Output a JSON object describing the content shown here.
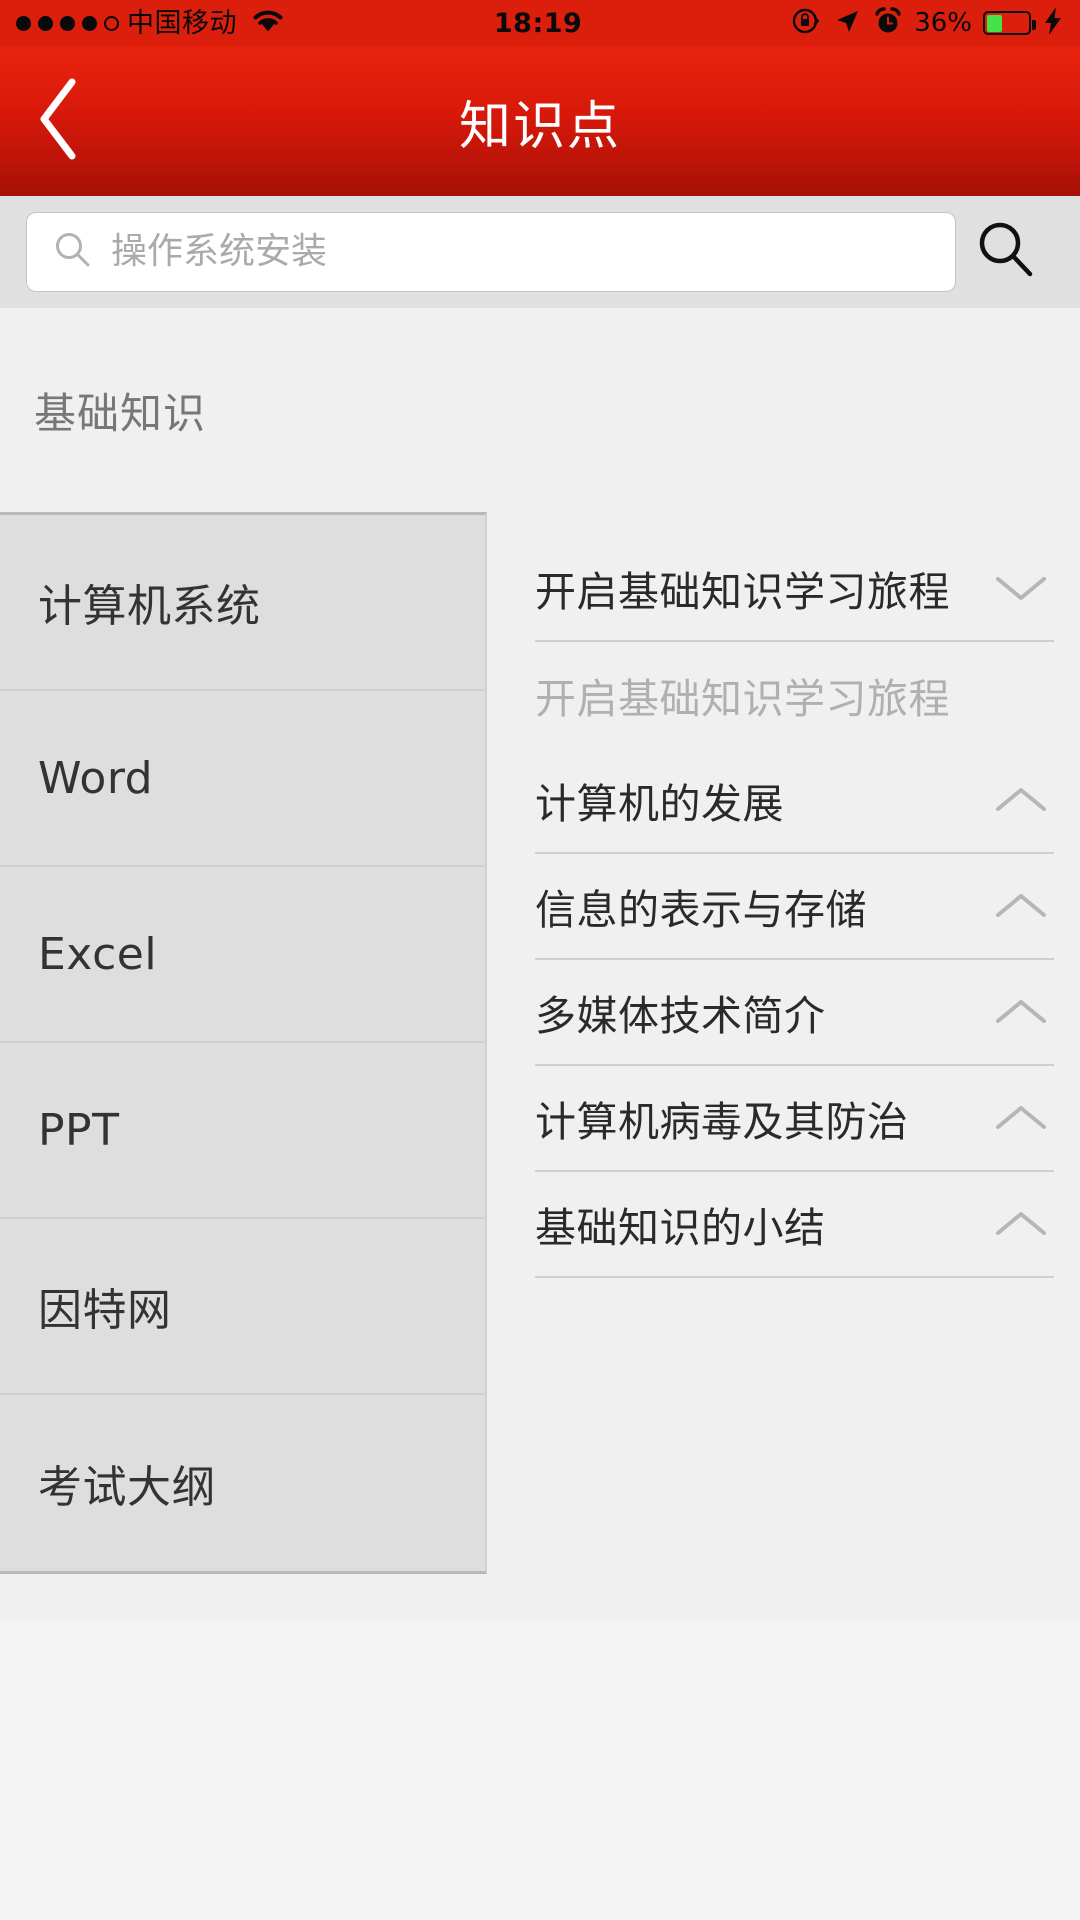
{
  "status_bar": {
    "carrier": "中国移动",
    "signal_dots_filled": 4,
    "signal_dots_total": 5,
    "wifi_icon": "wifi-icon",
    "time": "18:19",
    "rotation_lock_icon": "rotation-lock-icon",
    "location_icon": "location-arrow-icon",
    "alarm_icon": "alarm-clock-icon",
    "battery_percent": "36%",
    "battery_level": 36,
    "battery_color": "#45e24a",
    "charging_icon": "lightning-bolt-icon",
    "bg_color": "#dc1f0c"
  },
  "header": {
    "back_icon": "chevron-left-icon",
    "title": "知识点",
    "gradient_top": "#e8230d",
    "gradient_bottom": "#a51007",
    "title_color": "#ffffff"
  },
  "search": {
    "icon": "search-icon",
    "placeholder": "操作系统安装",
    "value": "",
    "submit_icon": "search-icon",
    "bar_bg": "#e0e0e0",
    "field_bg": "#ffffff"
  },
  "section": {
    "title": "基础知识",
    "title_color": "#777777"
  },
  "sidebar": {
    "bg_color": "#dedede",
    "items": [
      {
        "label": "计算机系统",
        "name": "sidebar-item-computer-system"
      },
      {
        "label": "Word",
        "name": "sidebar-item-word"
      },
      {
        "label": "Excel",
        "name": "sidebar-item-excel"
      },
      {
        "label": "PPT",
        "name": "sidebar-item-ppt"
      },
      {
        "label": "因特网",
        "name": "sidebar-item-internet"
      },
      {
        "label": "考试大纲",
        "name": "sidebar-item-exam-syllabus"
      }
    ]
  },
  "topics": {
    "bg_color": "#f0f0f0",
    "items": [
      {
        "label": "开启基础知识学习旅程",
        "chevron": "chevron-down-icon",
        "expanded": true,
        "muted": false
      },
      {
        "label": "开启基础知识学习旅程",
        "chevron": "none",
        "expanded": false,
        "muted": true
      },
      {
        "label": "计算机的发展",
        "chevron": "chevron-up-icon",
        "expanded": false,
        "muted": false
      },
      {
        "label": "信息的表示与存储",
        "chevron": "chevron-up-icon",
        "expanded": false,
        "muted": false
      },
      {
        "label": "多媒体技术简介",
        "chevron": "chevron-up-icon",
        "expanded": false,
        "muted": false
      },
      {
        "label": "计算机病毒及其防治",
        "chevron": "chevron-up-icon",
        "expanded": false,
        "muted": false
      },
      {
        "label": "基础知识的小结",
        "chevron": "chevron-up-icon",
        "expanded": false,
        "muted": false
      }
    ]
  }
}
